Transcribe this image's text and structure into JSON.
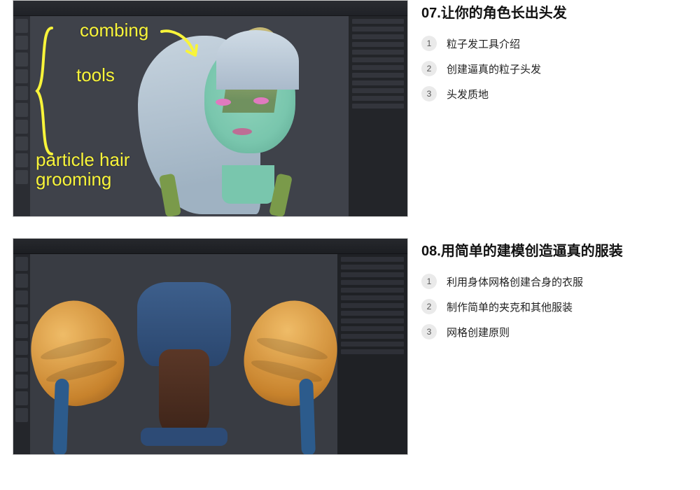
{
  "sections": [
    {
      "number": "07",
      "title": "让你的角色长出头发",
      "items": [
        "粒子发工具介绍",
        "创建逼真的粒子头发",
        "头发质地"
      ],
      "annotations": {
        "combing": "combing",
        "tools": "tools",
        "particle": "particle hair\ngrooming"
      }
    },
    {
      "number": "08",
      "title": "用简单的建模创造逼真的服装",
      "items": [
        "利用身体网格创建合身的衣服",
        "制作简单的夹克和其他服装",
        "网格创建原则"
      ]
    }
  ]
}
